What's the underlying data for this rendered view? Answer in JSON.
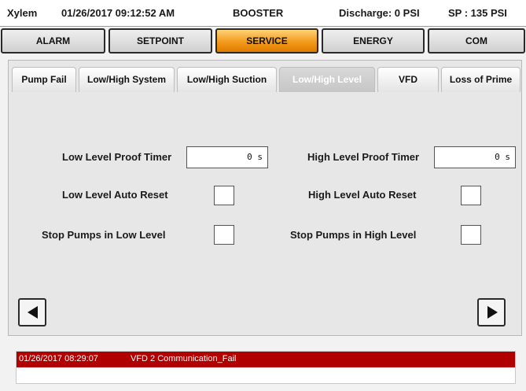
{
  "status": {
    "brand": "Xylem",
    "datetime": "01/26/2017 09:12:52 AM",
    "mode": "BOOSTER",
    "discharge": "Discharge: 0 PSI",
    "setpoint": "SP : 135 PSI"
  },
  "main_nav": {
    "items": [
      "ALARM",
      "SETPOINT",
      "SERVICE",
      "ENERGY",
      "COM"
    ],
    "active": "SERVICE"
  },
  "sub_tabs": {
    "items": [
      "Pump Fail",
      "Low/High System",
      "Low/High Suction",
      "Low/High Level",
      "VFD",
      "Loss of Prime"
    ],
    "active": "Low/High Level"
  },
  "form": {
    "low_level_proof_timer_label": "Low Level Proof Timer",
    "low_level_proof_timer_value": "0 s",
    "high_level_proof_timer_label": "High Level Proof Timer",
    "high_level_proof_timer_value": "0 s",
    "low_level_auto_reset_label": "Low Level Auto Reset",
    "high_level_auto_reset_label": "High Level Auto Reset",
    "stop_pumps_low_level_label": "Stop Pumps in Low Level",
    "stop_pumps_high_level_label": "Stop Pumps in High Level"
  },
  "alarm_log": {
    "timestamp": "01/26/2017 08:29:07",
    "message": "VFD 2 Communication_Fail"
  },
  "colors": {
    "active_tab": "#f29a1a",
    "alarm_bar": "#b00000"
  },
  "icons": {
    "prev": "triangle-left-icon",
    "next": "triangle-right-icon"
  }
}
